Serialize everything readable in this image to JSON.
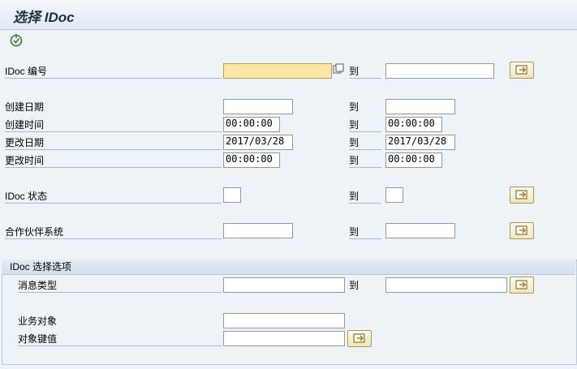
{
  "title": "选择 IDoc",
  "toolbar": {
    "execute_icon": "execute-icon"
  },
  "fields": {
    "idoc_number": {
      "label": "IDoc 编号",
      "low": "",
      "to": "到",
      "high": ""
    },
    "created_on": {
      "label": "创建日期",
      "low": "",
      "to": "到",
      "high": ""
    },
    "created_at": {
      "label": "创建时间",
      "low": "00:00:00",
      "to": "到",
      "high": "00:00:00"
    },
    "changed_on": {
      "label": "更改日期",
      "low": "2017/03/28",
      "to": "到",
      "high": "2017/03/28"
    },
    "changed_at": {
      "label": "更改时间",
      "low": "00:00:00",
      "to": "到",
      "high": "00:00:00"
    },
    "idoc_status": {
      "label": "IDoc 状态",
      "low": "",
      "to": "到",
      "high": ""
    },
    "partner_system": {
      "label": "合作伙伴系统",
      "low": "",
      "to": "到",
      "high": ""
    }
  },
  "group": {
    "title": "IDoc 选择选项",
    "message_type": {
      "label": "消息类型",
      "low": "",
      "to": "到",
      "high": ""
    },
    "business_object": {
      "label": "业务对象",
      "value": ""
    },
    "object_key": {
      "label": "对象键值",
      "value": ""
    }
  },
  "colors": {
    "required_bg": "#fbe6a2",
    "title_color": "#1e2f4a"
  }
}
